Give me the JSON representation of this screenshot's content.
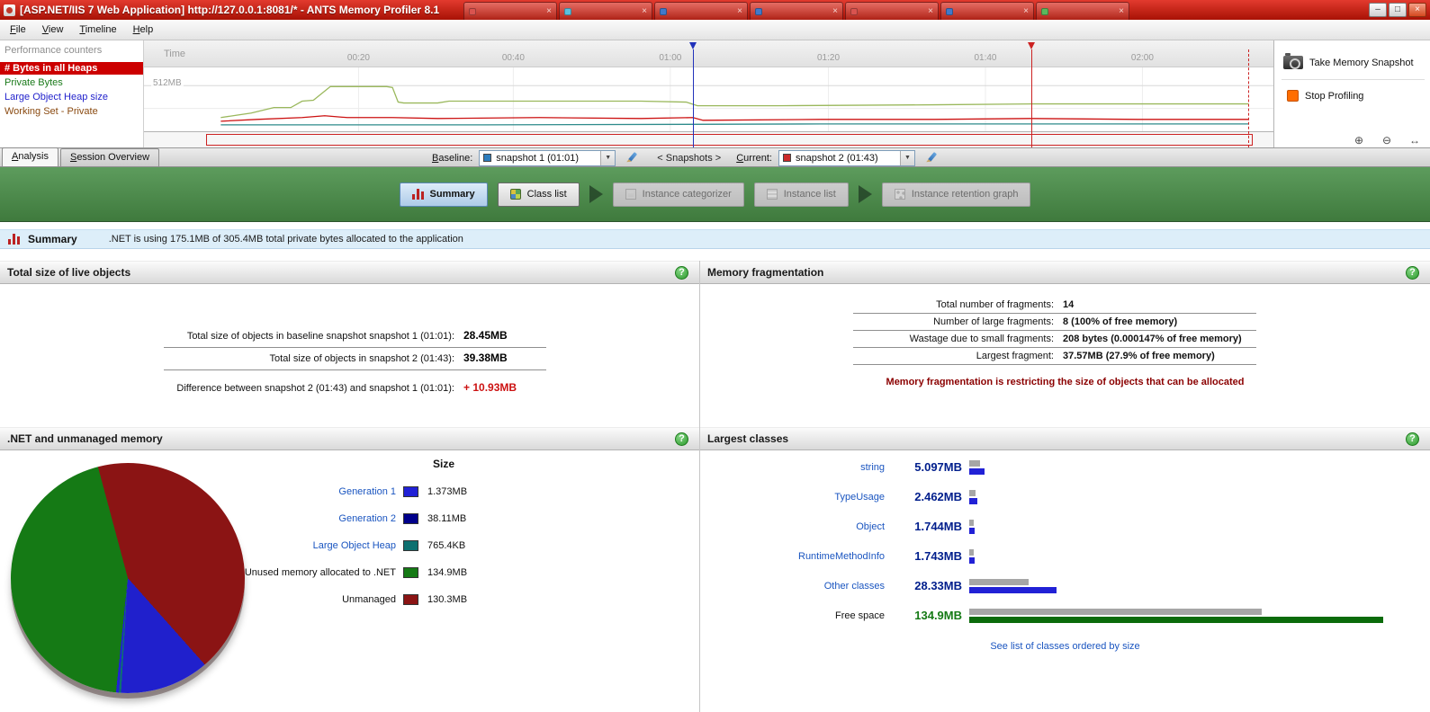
{
  "titlebar": {
    "title": "[ASP.NET/IIS 7 Web Application] http://127.0.0.1:8081/* - ANTS Memory Profiler 8.1",
    "tab_colors": [
      "#d9534f",
      "#5bc0de",
      "#4279ca",
      "#4279ca",
      "#d9534f",
      "#4279ca",
      "#5cb85c"
    ]
  },
  "icons": {
    "minimize": "–",
    "maximize": "□",
    "close": "×",
    "dropdown": "▼",
    "help": "?",
    "zoom_in": "⊕",
    "zoom_out": "⊖",
    "zoom_fit": "↔",
    "tab_close": "×"
  },
  "menu": {
    "items": [
      "File",
      "View",
      "Timeline",
      "Help"
    ]
  },
  "counters": {
    "header": "Performance counters",
    "items": [
      {
        "label": "# Bytes in all Heaps",
        "color": "#ffffff",
        "bg": "#cc0000"
      },
      {
        "label": "Private Bytes",
        "color": "#1a7a1a",
        "bg": ""
      },
      {
        "label": "Large Object Heap size",
        "color": "#2222cc",
        "bg": ""
      },
      {
        "label": "Working Set - Private",
        "color": "#8a4a10",
        "bg": ""
      }
    ]
  },
  "timeline": {
    "axis_title": "Time",
    "y_label": "512MB",
    "ticks": [
      {
        "label": "00:20",
        "pos": 19
      },
      {
        "label": "00:40",
        "pos": 32.7
      },
      {
        "label": "01:00",
        "pos": 46.6
      },
      {
        "label": "01:20",
        "pos": 60.6
      },
      {
        "label": "01:40",
        "pos": 74.5
      },
      {
        "label": "02:00",
        "pos": 88.4
      }
    ],
    "markers": {
      "baseline_pos": 48.6,
      "baseline_color": "#2233bb",
      "current_pos": 78.6,
      "current_color": "#cc2222",
      "live_pos": 97.8,
      "live_color": "#cc2222"
    },
    "series": [
      {
        "name": "private-bytes",
        "color": "#9ab85c",
        "points": [
          [
            6.8,
            55
          ],
          [
            9.5,
            50
          ],
          [
            11.5,
            44
          ],
          [
            13,
            44
          ],
          [
            14,
            37
          ],
          [
            15,
            36
          ],
          [
            16.5,
            21
          ],
          [
            21.5,
            21
          ],
          [
            22,
            22
          ],
          [
            22.5,
            38
          ],
          [
            23,
            39
          ],
          [
            26,
            39
          ],
          [
            27,
            37
          ],
          [
            35,
            37
          ],
          [
            44,
            37
          ],
          [
            48,
            38
          ],
          [
            49,
            42
          ],
          [
            56,
            42
          ],
          [
            70,
            41
          ],
          [
            78.6,
            40
          ],
          [
            88,
            40
          ],
          [
            97.8,
            40
          ]
        ]
      },
      {
        "name": "bytes-in-all-heaps",
        "color": "#cc1111",
        "points": [
          [
            6.8,
            59
          ],
          [
            10,
            57
          ],
          [
            14,
            55
          ],
          [
            16,
            53
          ],
          [
            18,
            55
          ],
          [
            22,
            55
          ],
          [
            26,
            56
          ],
          [
            35,
            55
          ],
          [
            44,
            56
          ],
          [
            48.6,
            55
          ],
          [
            49.5,
            58
          ],
          [
            60,
            57
          ],
          [
            70,
            57
          ],
          [
            78.6,
            56
          ],
          [
            88,
            57
          ],
          [
            97.8,
            57
          ]
        ]
      },
      {
        "name": "large-object-heap",
        "color": "#2e8b8b",
        "points": [
          [
            6.8,
            63
          ],
          [
            30,
            63
          ],
          [
            60,
            62
          ],
          [
            97.8,
            62
          ]
        ]
      }
    ]
  },
  "controls": {
    "take_snapshot": "Take Memory Snapshot",
    "stop_profiling": "Stop Profiling"
  },
  "tabs": {
    "analysis": "Analysis",
    "session_overview": "Session Overview"
  },
  "snapshots": {
    "baseline_label": "Baseline:",
    "baseline_value": "snapshot 1 (01:01)",
    "baseline_color": "#2d7dbd",
    "separator": "< Snapshots >",
    "current_label": "Current:",
    "current_value": "snapshot 2 (01:43)",
    "current_color": "#cc2a2a"
  },
  "workflow": {
    "arrows_after": [
      1,
      3
    ],
    "buttons": [
      {
        "label": "Summary",
        "state": "active"
      },
      {
        "label": "Class list",
        "state": "enabled"
      },
      {
        "label": "Instance categorizer",
        "state": "disabled"
      },
      {
        "label": "Instance list",
        "state": "disabled"
      },
      {
        "label": "Instance retention graph",
        "state": "disabled"
      }
    ]
  },
  "summary_bar": {
    "title": "Summary",
    "description": ".NET is using 175.1MB of 305.4MB total private bytes allocated to the application"
  },
  "live_objects": {
    "title": "Total size of live objects",
    "rows": [
      {
        "label": "Total size of objects in baseline snapshot snapshot 1 (01:01):",
        "value": "28.45MB",
        "value_color": "#000000"
      },
      {
        "label": "Total size of objects in snapshot 2 (01:43):",
        "value": "39.38MB",
        "value_color": "#000000"
      },
      {
        "label": "Difference between snapshot 2 (01:43) and snapshot 1 (01:01):",
        "value": "+ 10.93MB",
        "value_color": "#cc1111"
      }
    ]
  },
  "fragmentation": {
    "title": "Memory fragmentation",
    "rows": [
      {
        "label": "Total number of fragments:",
        "value": "14"
      },
      {
        "label": "Number of large fragments:",
        "value": "8 (100% of free memory)"
      },
      {
        "label": "Wastage due to small fragments:",
        "value": "208 bytes (0.000147% of free memory)"
      },
      {
        "label": "Largest fragment:",
        "value": "37.57MB (27.9% of free memory)"
      }
    ],
    "warning": "Memory fragmentation is restricting the size of objects that can be allocated"
  },
  "dotnet_memory": {
    "title": ".NET and unmanaged memory",
    "size_header": "Size",
    "legend": [
      {
        "label": "Generation 1",
        "link": true,
        "swatch": "#2121d6",
        "value": "1.373MB"
      },
      {
        "label": "Generation 2",
        "link": true,
        "swatch": "#00008b",
        "value": "38.11MB"
      },
      {
        "label": "Large Object Heap",
        "link": true,
        "swatch": "#0e7070",
        "value": "765.4KB"
      },
      {
        "label": "Unused memory allocated to .NET",
        "link": false,
        "swatch": "#157a15",
        "value": "134.9MB"
      },
      {
        "label": "Unmanaged",
        "link": false,
        "swatch": "#8b1414",
        "value": "130.3MB"
      }
    ],
    "pie": {
      "start_deg": -15,
      "slices": [
        {
          "name": "Unmanaged",
          "color": "#8b1414",
          "pct": 42.6
        },
        {
          "name": "Generation 2",
          "color": "#2020cc",
          "pct": 12.5
        },
        {
          "name": "Large Object Heap",
          "color": "#0e7070",
          "pct": 0.3
        },
        {
          "name": "Generation 1",
          "color": "#2121d6",
          "pct": 0.4
        },
        {
          "name": "Unused memory allocated to .NET",
          "color": "#157a15",
          "pct": 44.2
        }
      ]
    }
  },
  "largest_classes": {
    "title": "Largest classes",
    "rows": [
      {
        "label": "string",
        "link": true,
        "value": "5.097MB",
        "value_color": "#001e8c",
        "bar_color": "#2121d6",
        "baseline_w": 12,
        "current_w": 17
      },
      {
        "label": "TypeUsage",
        "link": true,
        "value": "2.462MB",
        "value_color": "#001e8c",
        "bar_color": "#2121d6",
        "baseline_w": 7,
        "current_w": 9
      },
      {
        "label": "Object",
        "link": true,
        "value": "1.744MB",
        "value_color": "#001e8c",
        "bar_color": "#2121d6",
        "baseline_w": 5,
        "current_w": 6
      },
      {
        "label": "RuntimeMethodInfo",
        "link": true,
        "value": "1.743MB",
        "value_color": "#001e8c",
        "bar_color": "#2121d6",
        "baseline_w": 5,
        "current_w": 6
      },
      {
        "label": "Other classes",
        "link": true,
        "value": "28.33MB",
        "value_color": "#001e8c",
        "bar_color": "#2121d6",
        "baseline_w": 66,
        "current_w": 97
      },
      {
        "label": "Free space",
        "link": false,
        "value": "134.9MB",
        "value_color": "#157a15",
        "bar_color": "#0b6b0b",
        "baseline_w": 325,
        "current_w": 460
      }
    ],
    "footer_link": "See list of classes ordered by size"
  }
}
